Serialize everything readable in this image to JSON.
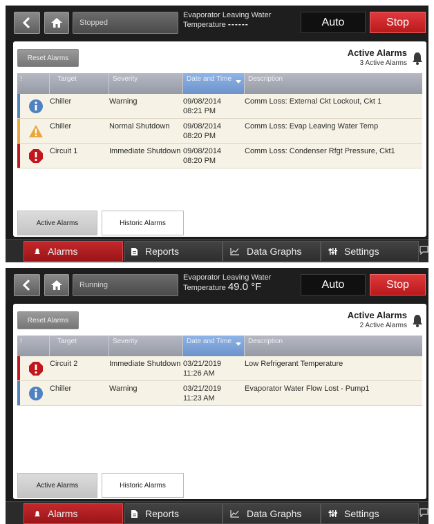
{
  "screens": [
    {
      "status": "Stopped",
      "temp_label": "Evaporator Leaving Water",
      "temp_label2": "Temperature",
      "temp_value": "------",
      "auto_label": "Auto",
      "stop_label": "Stop",
      "reset_label": "Reset Alarms",
      "active_title": "Active Alarms",
      "active_count": "3 Active Alarms",
      "columns": [
        "!",
        "Target",
        "Severity",
        "Date and Time",
        "Description"
      ],
      "rows": [
        {
          "level": "info",
          "target": "Chiller",
          "severity": "Warning",
          "date": "09/08/2014",
          "time": "08:21 PM",
          "description": "Comm Loss: External Ckt Lockout, Ckt 1"
        },
        {
          "level": "warning",
          "target": "Chiller",
          "severity": "Normal Shutdown",
          "date": "09/08/2014",
          "time": "08:20 PM",
          "description": "Comm Loss: Evap Leaving Water Temp"
        },
        {
          "level": "alarm",
          "target": "Circuit 1",
          "severity": "Immediate Shutdown",
          "date": "09/08/2014",
          "time": "08:20 PM",
          "description": "Comm Loss: Condenser Rfgt Pressure, Ckt1"
        }
      ],
      "tabs": [
        "Active Alarms",
        "Historic Alarms"
      ],
      "nav": [
        "Alarms",
        "Reports",
        "Data Graphs",
        "Settings"
      ]
    },
    {
      "status": "Running",
      "temp_label": "Evaporator Leaving Water",
      "temp_label2": "Temperature",
      "temp_value": "49.0 °F",
      "auto_label": "Auto",
      "stop_label": "Stop",
      "reset_label": "Reset Alarms",
      "active_title": "Active Alarms",
      "active_count": "2 Active Alarms",
      "columns": [
        "!",
        "Target",
        "Severity",
        "Date and Time",
        "Description"
      ],
      "rows": [
        {
          "level": "alarm",
          "target": "Circuit 2",
          "severity": "Immediate Shutdown",
          "date": "03/21/2019",
          "time": "11:26 AM",
          "description": "Low Refrigerant Temperature"
        },
        {
          "level": "info",
          "target": "Chiller",
          "severity": "Warning",
          "date": "03/21/2019",
          "time": "11:23 AM",
          "description": "Evaporator Water Flow Lost - Pump1"
        }
      ],
      "tabs": [
        "Active Alarms",
        "Historic Alarms"
      ],
      "nav": [
        "Alarms",
        "Reports",
        "Data Graphs",
        "Settings"
      ]
    }
  ],
  "colors": {
    "info": "#4f82c0",
    "warning": "#e8a63c",
    "alarm": "#c0161c",
    "stop": "#d12b2e",
    "sort_header": "#7ea3d9"
  },
  "icons": {
    "back": "chevron-left-icon",
    "home": "home-icon",
    "bell": "bell-icon",
    "info": "info-circle-icon",
    "warning": "warning-triangle-icon",
    "alarm": "exclamation-octagon-icon",
    "reports": "document-icon",
    "graphs": "line-chart-icon",
    "settings": "sliders-icon",
    "chat": "chat-bubble-icon"
  }
}
